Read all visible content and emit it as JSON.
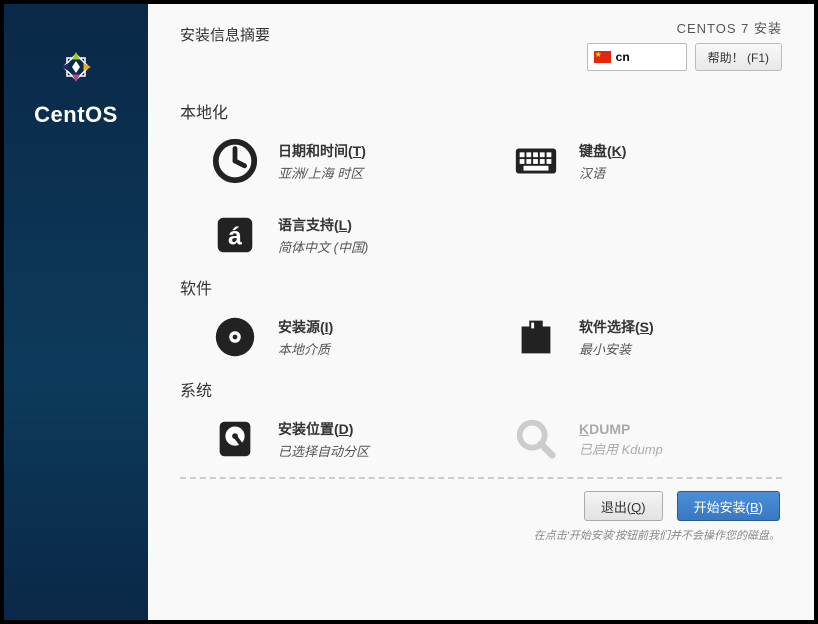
{
  "brand": {
    "name": "CentOS"
  },
  "header": {
    "title": "安装信息摘要",
    "install_label": "CENTOS 7 安装",
    "lang_code": "cn",
    "help_label": "帮助！ (F1)"
  },
  "categories": [
    {
      "label": "本地化",
      "spokes": [
        {
          "id": "datetime",
          "icon": "clock-icon",
          "title_pre": "日期和时间(",
          "title_u": "T",
          "title_post": ")",
          "sub": "亚洲/上海 时区",
          "disabled": false
        },
        {
          "id": "keyboard",
          "icon": "keyboard-icon",
          "title_pre": "键盘(",
          "title_u": "K",
          "title_post": ")",
          "sub": "汉语",
          "disabled": false
        },
        {
          "id": "language",
          "icon": "language-icon",
          "title_pre": "语言支持(",
          "title_u": "L",
          "title_post": ")",
          "sub": "简体中文 (中国)",
          "disabled": false
        }
      ]
    },
    {
      "label": "软件",
      "spokes": [
        {
          "id": "source",
          "icon": "disc-icon",
          "title_pre": "安装源(",
          "title_u": "I",
          "title_post": ")",
          "sub": "本地介质",
          "disabled": false
        },
        {
          "id": "software",
          "icon": "package-icon",
          "title_pre": "软件选择(",
          "title_u": "S",
          "title_post": ")",
          "sub": "最小安装",
          "disabled": false
        }
      ]
    },
    {
      "label": "系统",
      "spokes": [
        {
          "id": "destination",
          "icon": "hdd-icon",
          "title_pre": "安装位置(",
          "title_u": "D",
          "title_post": ")",
          "sub": "已选择自动分区",
          "disabled": false
        },
        {
          "id": "kdump",
          "icon": "search-icon",
          "title_pre": "",
          "title_u": "K",
          "title_post": "DUMP",
          "sub": "已启用 Kdump",
          "disabled": true
        }
      ]
    }
  ],
  "footer": {
    "quit_pre": "退出(",
    "quit_u": "Q",
    "quit_post": ")",
    "begin_pre": "开始安装(",
    "begin_u": "B",
    "begin_post": ")",
    "hint": "在点击'开始安装'按钮前我们并不会操作您的磁盘。"
  }
}
